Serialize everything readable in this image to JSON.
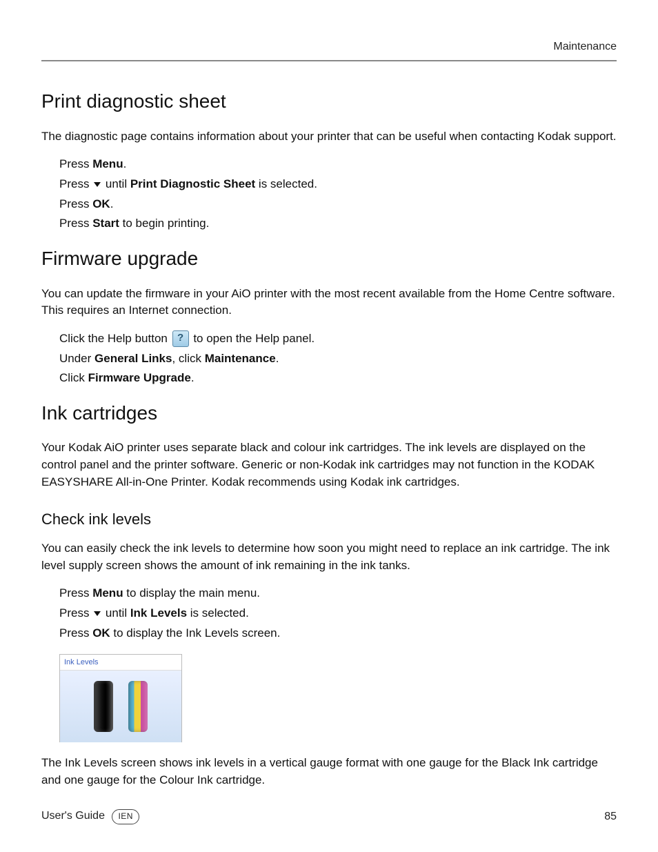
{
  "header": {
    "section": "Maintenance"
  },
  "print_diag": {
    "heading": "Print diagnostic sheet",
    "intro": "The diagnostic page contains information about your printer that can be useful when contacting Kodak support.",
    "s1a": "Press ",
    "s1b": "Menu",
    "s1c": ".",
    "s2a": "Press ",
    "s2b": " until ",
    "s2c": "Print Diagnostic Sheet",
    "s2d": " is selected.",
    "s3a": "Press ",
    "s3b": "OK",
    "s3c": ".",
    "s4a": "Press ",
    "s4b": "Start",
    "s4c": " to begin printing."
  },
  "firmware": {
    "heading": "Firmware upgrade",
    "intro": "You can update the firmware in your AiO printer with the most recent available from the Home Centre software. This requires an Internet connection.",
    "s1a": "Click the Help button ",
    "s1b": " to open the Help panel.",
    "s2a": "Under ",
    "s2b": "General Links",
    "s2c": ", click ",
    "s2d": "Maintenance",
    "s2e": ".",
    "s3a": "Click ",
    "s3b": "Firmware Upgrade",
    "s3c": "."
  },
  "ink": {
    "heading": "Ink cartridges",
    "intro": "Your Kodak AiO printer uses separate black and colour ink cartridges. The ink levels are displayed on the control panel and the printer software. Generic or non-Kodak ink cartridges may not function in the KODAK EASYSHARE All-in-One Printer. Kodak recommends using Kodak ink cartridges.",
    "sub": "Check ink levels",
    "sub_intro": "You can easily check the ink levels to determine how soon you might need to replace an ink cartridge. The ink level supply screen shows the amount of ink remaining in the ink tanks.",
    "s1a": "Press ",
    "s1b": "Menu",
    "s1c": " to display the main menu.",
    "s2a": "Press ",
    "s2b": " until ",
    "s2c": "Ink Levels",
    "s2d": " is selected.",
    "s3a": "Press ",
    "s3b": "OK",
    "s3c": " to display the Ink Levels screen.",
    "screen_label": "Ink Levels",
    "outro": "The Ink Levels screen shows ink levels in a vertical gauge format with one gauge for the Black Ink cartridge and one gauge for the Colour Ink cartridge."
  },
  "footer": {
    "guide": "User's Guide",
    "lang": "IEN",
    "page": "85"
  }
}
